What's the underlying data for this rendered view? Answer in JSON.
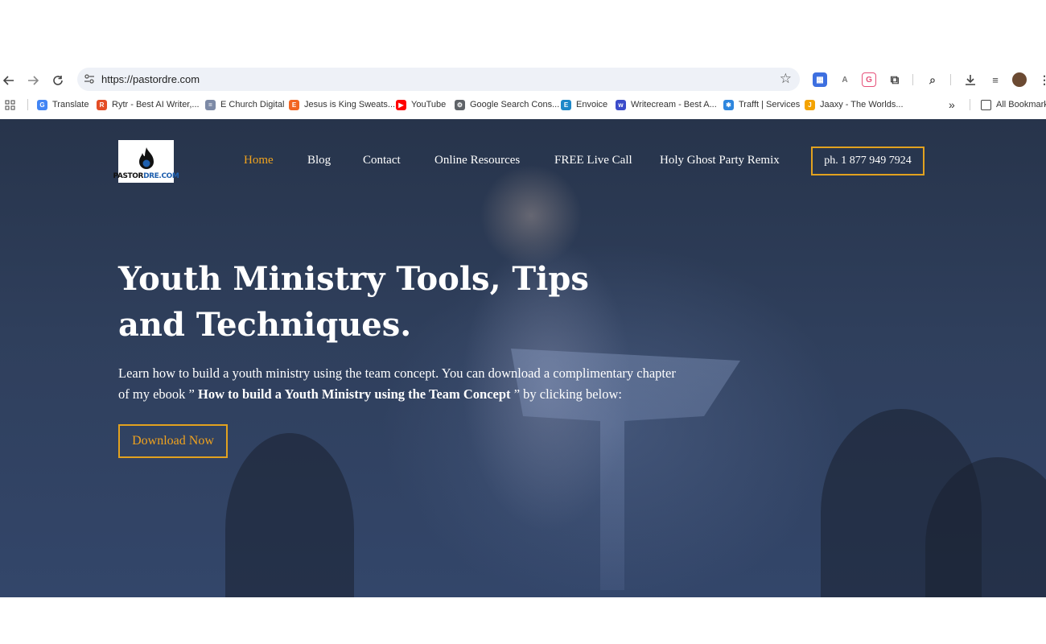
{
  "browser": {
    "url": "https://pastordre.com",
    "bookmarks": [
      {
        "label": "Translate",
        "color": "#4285f4",
        "glyph": "G"
      },
      {
        "label": "Rytr - Best AI Writer,...",
        "color": "#e44d26",
        "glyph": "R"
      },
      {
        "label": "E Church Digital",
        "color": "#7d8aa6",
        "glyph": "="
      },
      {
        "label": "Jesus is King Sweats...",
        "color": "#f26522",
        "glyph": "E"
      },
      {
        "label": "YouTube",
        "color": "#ff0000",
        "glyph": "▶"
      },
      {
        "label": "Google Search Cons...",
        "color": "#5f6368",
        "glyph": "⚙"
      },
      {
        "label": "Envoice",
        "color": "#1e88c8",
        "glyph": "E"
      },
      {
        "label": "Writecream - Best A...",
        "color": "#3b4cca",
        "glyph": "w"
      },
      {
        "label": "Trafft | Services",
        "color": "#2e86de",
        "glyph": "✱"
      },
      {
        "label": "Jaaxy - The Worlds...",
        "color": "#f4a300",
        "glyph": "J"
      }
    ],
    "bookmarks_overflow": "»",
    "all_bookmarks": "All Bookmark"
  },
  "site": {
    "logo_text_black": "PASTOR",
    "logo_text_blue": "DRE.COM",
    "nav": [
      "Home",
      "Blog",
      "Contact",
      "Online Resources",
      "FREE Live Call",
      "Holy Ghost Party Remix"
    ],
    "phone": "ph. 1 877 949 7924",
    "headline": "Youth Ministry Tools, Tips and Techniques.",
    "para_before": "Learn how to build a youth ministry using the team concept. You can download a complimentary chapter of my ebook ” ",
    "para_bold": "How to build a Youth Ministry using the Team Concept",
    "para_after": " ” by clicking below:",
    "cta": "Download Now"
  },
  "colors": {
    "accent": "#f0a31e",
    "hero_bg": "#2f3f5c"
  },
  "icons": [
    "back-arrow-icon",
    "forward-arrow-icon",
    "reload-icon",
    "site-settings-icon",
    "star-icon",
    "downloads-icon",
    "profile-avatar"
  ]
}
